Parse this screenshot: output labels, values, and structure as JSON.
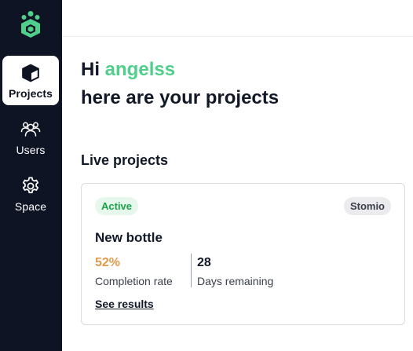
{
  "sidebar": {
    "items": [
      {
        "label": "Projects",
        "icon": "cube-icon",
        "active": true
      },
      {
        "label": "Users",
        "icon": "users-icon",
        "active": false
      },
      {
        "label": "Space",
        "icon": "gear-icon",
        "active": false
      }
    ]
  },
  "main": {
    "greeting_prefix": "Hi",
    "user_name": "angelss",
    "greeting_line2": "here are your projects",
    "section_title": "Live projects"
  },
  "project_card": {
    "status": "Active",
    "client": "Stomio",
    "name": "New bottle",
    "completion_value": "52%",
    "completion_label": "Completion rate",
    "days_value": "28",
    "days_label": "Days remaining",
    "link_label": "See results"
  },
  "colors": {
    "sidebar_bg": "#0e1424",
    "accent_green": "#4fcf8a",
    "status_green": "#1aa34a",
    "completion_orange": "#e29a4c"
  }
}
